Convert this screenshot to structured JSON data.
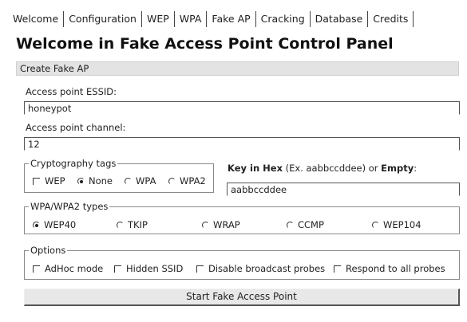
{
  "tabs": [
    "Welcome",
    "Configuration",
    "WEP",
    "WPA",
    "Fake AP",
    "Cracking",
    "Database",
    "Credits"
  ],
  "page_title": "Welcome in Fake Access Point Control Panel",
  "section_title": "Create Fake AP",
  "essid": {
    "label": "Access point ESSID:",
    "value": "honeypot"
  },
  "channel": {
    "label": "Access point channel:",
    "value": "12"
  },
  "crypto": {
    "legend": "Cryptography tags",
    "options": [
      {
        "label": "WEP",
        "kind": "checkbox",
        "checked": false
      },
      {
        "label": "None",
        "kind": "radio",
        "checked": true
      },
      {
        "label": "WPA",
        "kind": "radio",
        "checked": false
      },
      {
        "label": "WPA2",
        "kind": "radio",
        "checked": false
      }
    ]
  },
  "key": {
    "label_bold": "Key in Hex",
    "label_mid": " (Ex. aabbccddee) or ",
    "label_bold2": "Empty",
    "label_end": ":",
    "value": "aabbccddee"
  },
  "wpa_types": {
    "legend": "WPA/WPA2 types",
    "options": [
      {
        "label": "WEP40",
        "checked": true
      },
      {
        "label": "TKIP",
        "checked": false
      },
      {
        "label": "WRAP",
        "checked": false
      },
      {
        "label": "CCMP",
        "checked": false
      },
      {
        "label": "WEP104",
        "checked": false
      }
    ]
  },
  "options": {
    "legend": "Options",
    "items": [
      {
        "label": "AdHoc mode",
        "checked": false
      },
      {
        "label": "Hidden SSID",
        "checked": false
      },
      {
        "label": "Disable broadcast probes",
        "checked": false
      },
      {
        "label": "Respond to all probes",
        "checked": false
      }
    ]
  },
  "start_button": "Start Fake Access Point"
}
